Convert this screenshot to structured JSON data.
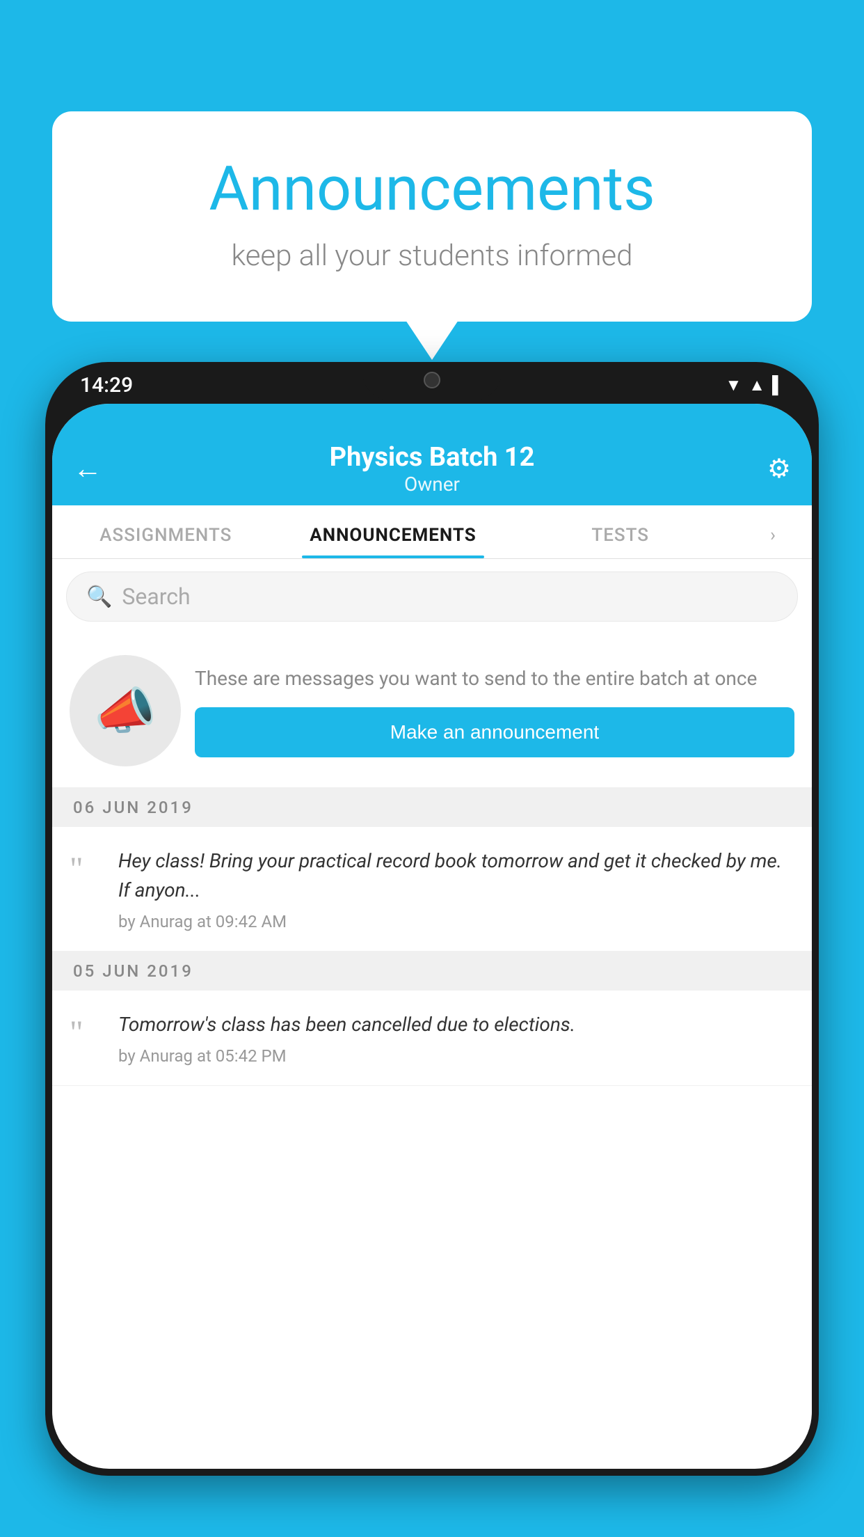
{
  "background_color": "#1DB8E8",
  "speech_bubble": {
    "title": "Announcements",
    "subtitle": "keep all your students informed"
  },
  "phone": {
    "status_bar": {
      "time": "14:29",
      "icons": [
        "▼",
        "▲",
        "▌"
      ]
    },
    "header": {
      "title": "Physics Batch 12",
      "subtitle": "Owner",
      "back_label": "←"
    },
    "tabs": [
      {
        "label": "ASSIGNMENTS",
        "active": false
      },
      {
        "label": "ANNOUNCEMENTS",
        "active": true
      },
      {
        "label": "TESTS",
        "active": false
      }
    ],
    "search": {
      "placeholder": "Search"
    },
    "promo": {
      "description": "These are messages you want to send to the entire batch at once",
      "button_label": "Make an announcement"
    },
    "announcements": [
      {
        "date": "06  JUN  2019",
        "text": "Hey class! Bring your practical record book tomorrow and get it checked by me. If anyon...",
        "author": "by Anurag at 09:42 AM"
      },
      {
        "date": "05  JUN  2019",
        "text": "Tomorrow's class has been cancelled due to elections.",
        "author": "by Anurag at 05:42 PM"
      }
    ]
  }
}
